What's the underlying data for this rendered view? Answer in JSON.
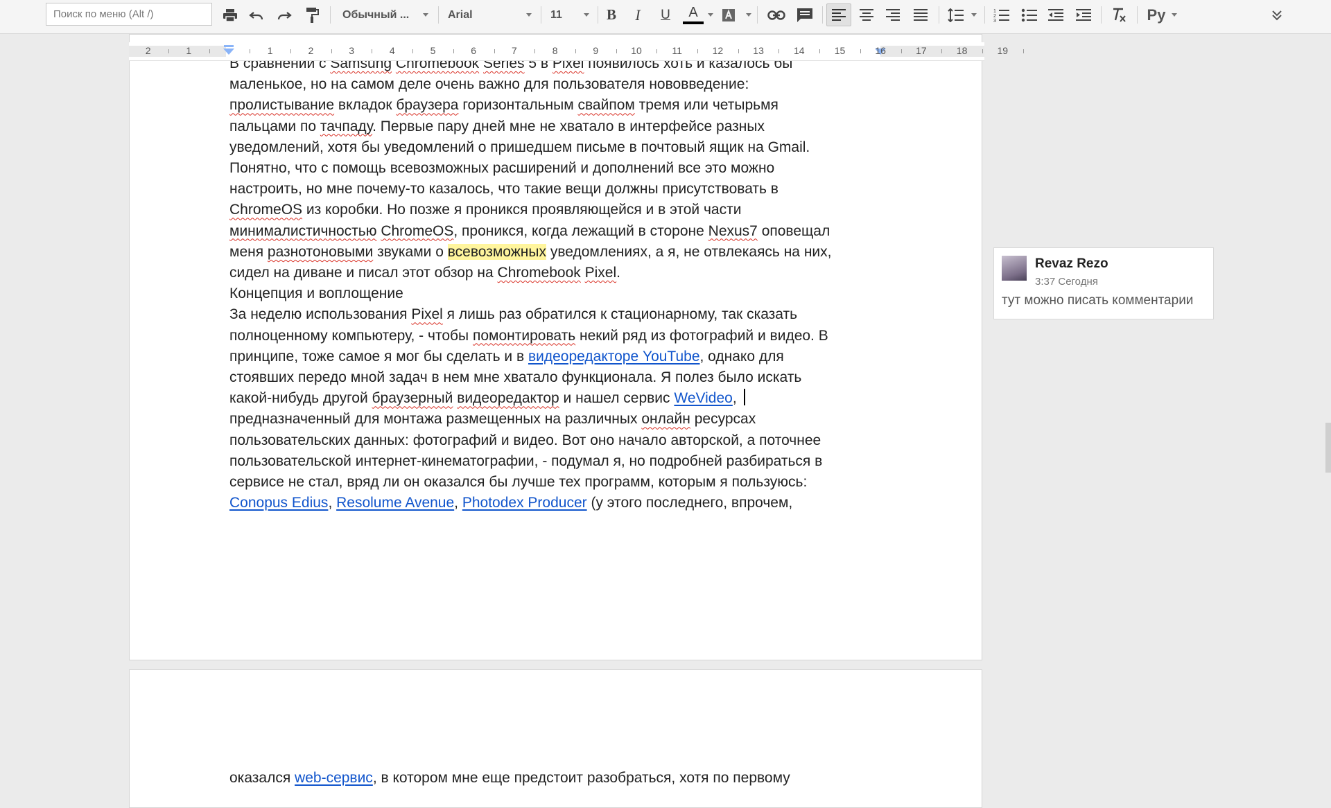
{
  "toolbar": {
    "search_placeholder": "Поиск по меню (Alt /)",
    "style_value": "Обычный ...",
    "font_value": "Arial",
    "size_value": "11",
    "bold_label": "B",
    "italic_label": "I",
    "underline_label": "U",
    "text_color_label": "A",
    "input_tools_label": "Ру",
    "text_color": "#000000",
    "icons": [
      "print-icon",
      "undo-icon",
      "redo-icon",
      "paint-format-icon",
      "link-icon",
      "comment-icon",
      "align-left-icon",
      "align-center-icon",
      "align-right-icon",
      "align-justify-icon",
      "line-spacing-icon",
      "numbered-list-icon",
      "bulleted-list-icon",
      "decrease-indent-icon",
      "increase-indent-icon",
      "clear-formatting-icon",
      "collapse-icon"
    ]
  },
  "ruler": {
    "numbers": [
      "2",
      "1",
      "1",
      "2",
      "3",
      "4",
      "5",
      "6",
      "7",
      "8",
      "9",
      "10",
      "11",
      "12",
      "13",
      "14",
      "15",
      "16",
      "17",
      "18",
      "19"
    ]
  },
  "document": {
    "page1_lines": [
      [
        {
          "t": "В сравнении с "
        },
        {
          "t": "Samsung",
          "s": 1
        },
        {
          "t": " "
        },
        {
          "t": "Chromebook",
          "s": 1
        },
        {
          "t": " "
        },
        {
          "t": "Series",
          "s": 1
        },
        {
          "t": " 5 в "
        },
        {
          "t": "Pixel",
          "s": 1
        },
        {
          "t": " появилось хоть и казалось бы"
        }
      ],
      [
        {
          "t": "маленькое, но на самом деле очень важно для пользователя нововведение:"
        }
      ],
      [
        {
          "t": "пролистывание",
          "s": 1
        },
        {
          "t": " вкладок "
        },
        {
          "t": "браузера",
          "s": 1
        },
        {
          "t": " горизонтальным "
        },
        {
          "t": "свайпом",
          "s": 1
        },
        {
          "t": " тремя или четырьмя"
        }
      ],
      [
        {
          "t": "пальцами по "
        },
        {
          "t": "тачпаду",
          "s": 1
        },
        {
          "t": ". Первые пару дней мне не хватало в интерфейсе разных"
        }
      ],
      [
        {
          "t": "уведомлений, хотя бы уведомлений о пришедшем письме в почтовый ящик на Gmail."
        }
      ],
      [
        {
          "t": "Понятно, что с помощь всевозможных расширений и дополнений все это можно"
        }
      ],
      [
        {
          "t": "настроить, но мне почему-то казалось, что такие вещи должны присутствовать в"
        }
      ],
      [
        {
          "t": "ChromeOS",
          "s": 1
        },
        {
          "t": " из коробки. Но позже я проникся проявляющейся и в этой части"
        }
      ],
      [
        {
          "t": "минималистичностью",
          "s": 1
        },
        {
          "t": " "
        },
        {
          "t": "ChromeOS",
          "s": 1
        },
        {
          "t": ", проникся, когда лежащий в стороне "
        },
        {
          "t": "Nexus7",
          "s": 1
        },
        {
          "t": " оповещал"
        }
      ],
      [
        {
          "t": "меня "
        },
        {
          "t": "разнотоновыми",
          "s": 1
        },
        {
          "t": " звуками о "
        },
        {
          "t": "всевозможных",
          "h": 1
        },
        {
          "t": " уведомлениях, а я, не отвлекаясь на них,"
        }
      ],
      [
        {
          "t": "сидел на диване и писал этот обзор на "
        },
        {
          "t": "Chromebook",
          "s": 1
        },
        {
          "t": " "
        },
        {
          "t": "Pixel",
          "s": 1
        },
        {
          "t": "."
        }
      ],
      [
        {
          "t": " "
        }
      ],
      [
        {
          "t": "Концепция и воплощение"
        }
      ],
      [
        {
          "t": " "
        }
      ],
      [
        {
          "t": "За неделю использования "
        },
        {
          "t": "Pixel",
          "s": 1
        },
        {
          "t": " я лишь раз обратился к стационарному, так сказать"
        }
      ],
      [
        {
          "t": "полноценному компьютеру, - чтобы "
        },
        {
          "t": "помонтировать",
          "s": 1
        },
        {
          "t": " некий ряд из фотографий и видео. В"
        }
      ],
      [
        {
          "t": "принципе, тоже самое я мог бы сделать и в "
        },
        {
          "t": "видеоредакторе YouTube",
          "l": 1
        },
        {
          "t": ", однако для"
        }
      ],
      [
        {
          "t": "стоявших передо мной задач в нем мне хватало функционала. Я полез было искать"
        }
      ],
      [
        {
          "t": "какой-нибудь другой "
        },
        {
          "t": "браузерный",
          "s": 1
        },
        {
          "t": " "
        },
        {
          "t": "видеоредактор",
          "s": 1
        },
        {
          "t": " и нашел сервис "
        },
        {
          "t": "WeVideo",
          "l": 1
        },
        {
          "t": ","
        },
        {
          "c": 1
        }
      ],
      [
        {
          "t": "предназначенный для монтажа размещенных на различных "
        },
        {
          "t": "онлайн",
          "s": 1
        },
        {
          "t": " ресурсах"
        }
      ],
      [
        {
          "t": "пользовательских данных: фотографий и видео. Вот оно начало авторской, а поточнее"
        }
      ],
      [
        {
          "t": "пользовательской интернет-кинематографии, - подумал я, но подробней разбираться в"
        }
      ],
      [
        {
          "t": "сервисе не стал, вряд ли он оказался бы лучше тех программ, которым я пользуюсь:"
        }
      ],
      [
        {
          "t": "Conopus Edius",
          "l": 1
        },
        {
          "t": ", "
        },
        {
          "t": "Resolume Avenue",
          "l": 1
        },
        {
          "t": ", "
        },
        {
          "t": "Photodex Producer",
          "l": 1
        },
        {
          "t": " (у этого последнего, впрочем,"
        }
      ]
    ],
    "page2_lines": [
      [
        {
          "t": "оказался "
        },
        {
          "t": "web-сервис",
          "l": 1
        },
        {
          "t": ", в котором мне еще предстоит разобраться, хотя по первому"
        }
      ]
    ]
  },
  "comment": {
    "author": "Revaz Rezo",
    "time": "3:37 Сегодня",
    "text": "тут можно писать комментарии"
  },
  "colors": {
    "link": "#1155cc",
    "highlight": "#fff59d",
    "spellcheck": "#d93025",
    "ruler_marker": "#8ab4f8"
  }
}
